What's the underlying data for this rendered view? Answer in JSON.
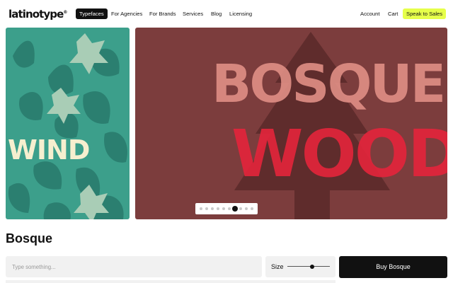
{
  "header": {
    "logo_text": "latinotype",
    "logo_mark": "®",
    "nav": [
      {
        "label": "Typefaces",
        "active": true
      },
      {
        "label": "For Agencies",
        "active": false
      },
      {
        "label": "For Brands",
        "active": false
      },
      {
        "label": "Services",
        "active": false
      },
      {
        "label": "Blog",
        "active": false
      },
      {
        "label": "Licensing",
        "active": false
      }
    ],
    "account_label": "Account",
    "cart_label": "Cart",
    "cta_label": "Speak to Sales",
    "cta_color": "#e6ff4a"
  },
  "carousel": {
    "slides": [
      {
        "word": "WIND",
        "background": "#3c9f8b",
        "text_color": "#f6efcf"
      },
      {
        "words": [
          "BOSQUE",
          "WOOD"
        ],
        "background": "#7c3d3d",
        "colors": [
          "#e08f86",
          "#e2253b"
        ]
      }
    ],
    "page_count": 10,
    "current_page": 6
  },
  "typeface": {
    "name": "Bosque"
  },
  "tester": {
    "placeholder": "Type something...",
    "size_label": "Size",
    "size_level": 0.6,
    "buy_label": "Buy Bosque"
  }
}
